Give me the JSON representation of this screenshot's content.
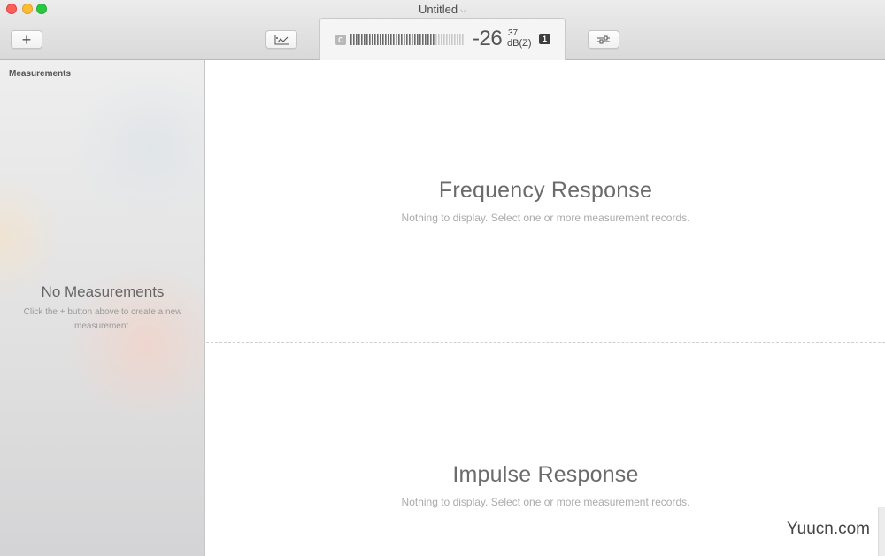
{
  "window": {
    "title": "Untitled",
    "title_chevron": "⌵"
  },
  "toolbar": {
    "add_label": "+",
    "chart_icon": "chart-icon",
    "settings_icon": "sliders-icon"
  },
  "meter": {
    "weighting_badge": "C",
    "level_fraction": 0.75,
    "reading": "-26",
    "decimals": "37",
    "unit": "dB(Z)",
    "channel_badge": "1"
  },
  "sidebar": {
    "heading": "Measurements",
    "empty_title": "No Measurements",
    "empty_hint": "Click the + button above to create a new measurement."
  },
  "panes": {
    "frequency": {
      "title": "Frequency Response",
      "subtitle": "Nothing to display. Select one or more measurement records."
    },
    "impulse": {
      "title": "Impulse Response",
      "subtitle": "Nothing to display. Select one or more measurement records."
    }
  },
  "watermark": "Yuucn.com",
  "colors": {
    "close": "#fc5f57",
    "minimize": "#fdbc2e",
    "maximize": "#28c840"
  }
}
